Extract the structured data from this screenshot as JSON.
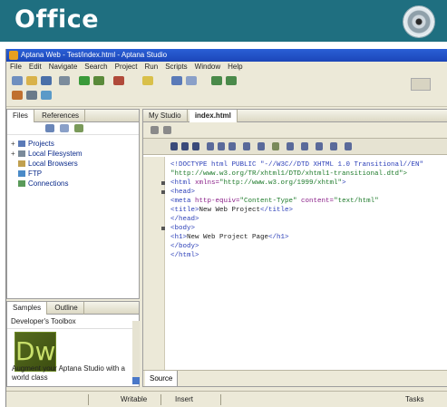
{
  "magazine": {
    "section_title": "Office",
    "cd_icon": "cd-disc-icon"
  },
  "window": {
    "title": "Aptana Web - Test/index.html - Aptana Studio",
    "menu": [
      "File",
      "Edit",
      "Navigate",
      "Search",
      "Project",
      "Run",
      "Scripts",
      "Window",
      "Help"
    ]
  },
  "left_panel": {
    "tabs": [
      "Files",
      "References"
    ],
    "tree": [
      {
        "label": "Projects",
        "expander": "+"
      },
      {
        "label": "Local Filesystem",
        "expander": "+"
      },
      {
        "label": "Local Browsers",
        "expander": ""
      },
      {
        "label": "FTP",
        "expander": ""
      },
      {
        "label": "Connections",
        "expander": ""
      }
    ]
  },
  "samples_panel": {
    "tabs": [
      "Samples",
      "Outline"
    ],
    "header": "Developer's Toolbox",
    "logo_text": "Dw",
    "promo_text": "Augment your Aptana Studio with a world class"
  },
  "editor": {
    "tabs": [
      "My Studio",
      "index.html"
    ],
    "code_lines": [
      {
        "parts": [
          {
            "t": "tag",
            "v": "<!DOCTYPE html PUBLIC \"-//W3C//DTD XHTML 1.0 Transitional//EN\""
          }
        ]
      },
      {
        "parts": [
          {
            "t": "str",
            "v": "\"http://www.w3.org/TR/xhtml1/DTD/xhtml1-transitional.dtd\">"
          }
        ]
      },
      {
        "parts": [
          {
            "t": "tag",
            "v": "<html "
          },
          {
            "t": "attr",
            "v": "xmlns="
          },
          {
            "t": "str",
            "v": "\"http://www.w3.org/1999/xhtml\""
          },
          {
            "t": "tag",
            "v": ">"
          }
        ]
      },
      {
        "parts": [
          {
            "t": "tag",
            "v": "    <head>"
          }
        ]
      },
      {
        "parts": [
          {
            "t": "tag",
            "v": "        <meta "
          },
          {
            "t": "attr",
            "v": "http-equiv="
          },
          {
            "t": "str",
            "v": "\"Content-Type\" "
          },
          {
            "t": "attr",
            "v": "content="
          },
          {
            "t": "str",
            "v": "\"text/html\""
          }
        ]
      },
      {
        "parts": [
          {
            "t": "tag",
            "v": "        <title>"
          },
          {
            "t": "txt",
            "v": "New Web Project"
          },
          {
            "t": "tag",
            "v": "</title>"
          }
        ]
      },
      {
        "parts": [
          {
            "t": "tag",
            "v": "    </head>"
          }
        ]
      },
      {
        "parts": [
          {
            "t": "tag",
            "v": "    <body>"
          }
        ]
      },
      {
        "parts": [
          {
            "t": "tag",
            "v": "        <h1>"
          },
          {
            "t": "txt",
            "v": "New Web Project Page"
          },
          {
            "t": "tag",
            "v": "</h1>"
          }
        ]
      },
      {
        "parts": [
          {
            "t": "tag",
            "v": "    </body>"
          }
        ]
      },
      {
        "parts": [
          {
            "t": "tag",
            "v": "</html>"
          }
        ]
      }
    ],
    "bottom_tab": "Source"
  },
  "statusbar": {
    "mode": "Writable",
    "insert": "Insert",
    "right": "Tasks"
  }
}
